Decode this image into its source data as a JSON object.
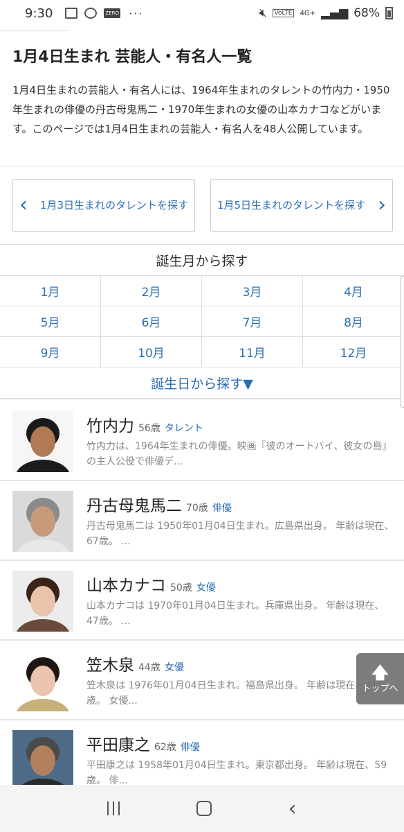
{
  "status_bar": {
    "time": "9:30",
    "network": "4G+",
    "volte": "VoLTE",
    "battery": "68%",
    "zero_label": "ZERO",
    "dots": "···"
  },
  "page": {
    "title": "1月4日生まれ 芸能人・有名人一覧",
    "intro": "1月4日生まれの芸能人・有名人には、1964年生まれのタレントの竹内力・1950年生まれの俳優の丹古母鬼馬二・1970年生まれの女優の山本カナコなどがいます。このページでは1月4日生まれの芸能人・有名人を48人公開しています。"
  },
  "nav": {
    "prev_label": "1月3日生まれのタレントを探す",
    "next_label": "1月5日生まれのタレントを探す"
  },
  "month_search": {
    "heading": "誕生月から探す",
    "months": [
      "1月",
      "2月",
      "3月",
      "4月",
      "5月",
      "6月",
      "7月",
      "8月",
      "9月",
      "10月",
      "11月",
      "12月"
    ]
  },
  "day_search": {
    "heading": "誕生日から探す▼"
  },
  "people": [
    {
      "name": "竹内力",
      "age": "56歳",
      "job": "タレント",
      "desc": "竹内力は、1964年生まれの俳優。映画『彼のオートバイ、彼女の島』の主人公役で俳優デ...",
      "hair": "#1a1a1a",
      "skin": "#b07a55",
      "shirt": "#1c1c1c",
      "bg": "#f6f6f6"
    },
    {
      "name": "丹古母鬼馬二",
      "age": "70歳",
      "job": "俳優",
      "desc": "丹古母鬼馬二は 1950年01月04日生まれ。広島県出身。 年齢は現在、67歳。 ...",
      "hair": "#8a8a8a",
      "skin": "#c79a7c",
      "shirt": "#e8e8e8",
      "bg": "#dadada"
    },
    {
      "name": "山本カナコ",
      "age": "50歳",
      "job": "女優",
      "desc": "山本カナコは 1970年01月04日生まれ。兵庫県出身。 年齢は現在、47歳。 ...",
      "hair": "#3a2418",
      "skin": "#e9c3ab",
      "shirt": "#6a4a3a",
      "bg": "#ececec"
    },
    {
      "name": "笠木泉",
      "age": "44歳",
      "job": "女優",
      "desc": "笠木泉は 1976年01月04日生まれ。福島県出身。 年齢は現在、41歳。 女優...",
      "hair": "#1e1612",
      "skin": "#eac4ae",
      "shirt": "#c7b07a",
      "bg": "#ffffff"
    },
    {
      "name": "平田康之",
      "age": "62歳",
      "job": "俳優",
      "desc": "平田康之は 1958年01月04日生まれ。東京都出身。 年齢は現在、59歳。 俳...",
      "hair": "#4a4a4a",
      "skin": "#b3805e",
      "shirt": "#2a2a2a",
      "bg": "#4d6b87"
    }
  ],
  "top_button": {
    "label": "トップへ",
    "arrow": "🡅"
  }
}
